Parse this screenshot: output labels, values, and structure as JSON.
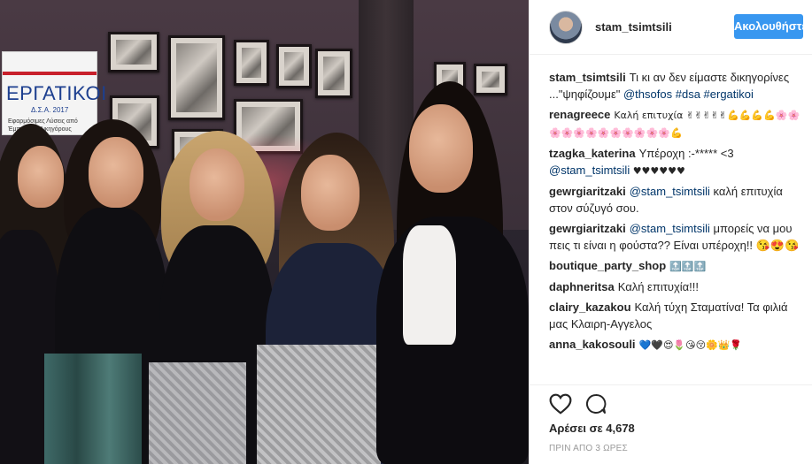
{
  "photo": {
    "banner_title": "ΕΡΓΑΤΙΚΟΙ",
    "banner_sub": "Δ.Σ.Α. 2017",
    "banner_line": "Εφαρμόσιμες Λύσεις από Έμπειρους Δικηγόρους"
  },
  "header": {
    "username": "stam_tsimtsili",
    "follow_label": "Ακολουθήστε",
    "avatar_icon": "profile-avatar",
    "accent_color": "#3897f0"
  },
  "caption": {
    "author": "stam_tsimtsili",
    "text": "Τι κι αν δεν είμαστε δικηγορίνες ...\"ψηφίζουμε\" ",
    "mention": "@thsofos",
    "tags": "#dsa #ergatikoi"
  },
  "comments": [
    {
      "author": "renagreece",
      "text": "Καλή επιτυχία ✌✌✌✌✌💪💪💪💪🌸🌸🌸🌸🌸🌸🌸🌸🌸🌸🌸🌸💪"
    },
    {
      "author": "tzagka_katerina",
      "text": "Υπέροχη :-***** <3 ",
      "mention": "@stam_tsimtsili",
      "suffix": " ♥♥♥♥♥♥"
    },
    {
      "author": "gewrgiaritzaki",
      "mention": "@stam_tsimtsili",
      "text": " καλή επιτυχία στον σύζυγό σου."
    },
    {
      "author": "gewrgiaritzaki",
      "mention": "@stam_tsimtsili",
      "text": " μπορείς να μου πεις τι είναι η φούστα?? Είναι υπέροχη!! 😘😍😘"
    },
    {
      "author": "boutique_party_shop",
      "text": "🔝🔝🔝"
    },
    {
      "author": "daphneritsa",
      "text": "Καλή επιτυχία!!!"
    },
    {
      "author": "clairy_kazakou",
      "text": "Καλή τύχη Σταματίνα! Τα φιλιά μας Κλαιρη-Αγγελος"
    },
    {
      "author": "anna_kakosouli",
      "text": "💙🖤😍🌷😘😚🌼👑🌹"
    }
  ],
  "actions": {
    "like_icon": "heart-icon",
    "comment_icon": "comment-icon",
    "likes_text": "Αρέσει σε 4,678",
    "timestamp": "ΠΡΙΝ ΑΠΟ 3 ΩΡΕΣ"
  }
}
